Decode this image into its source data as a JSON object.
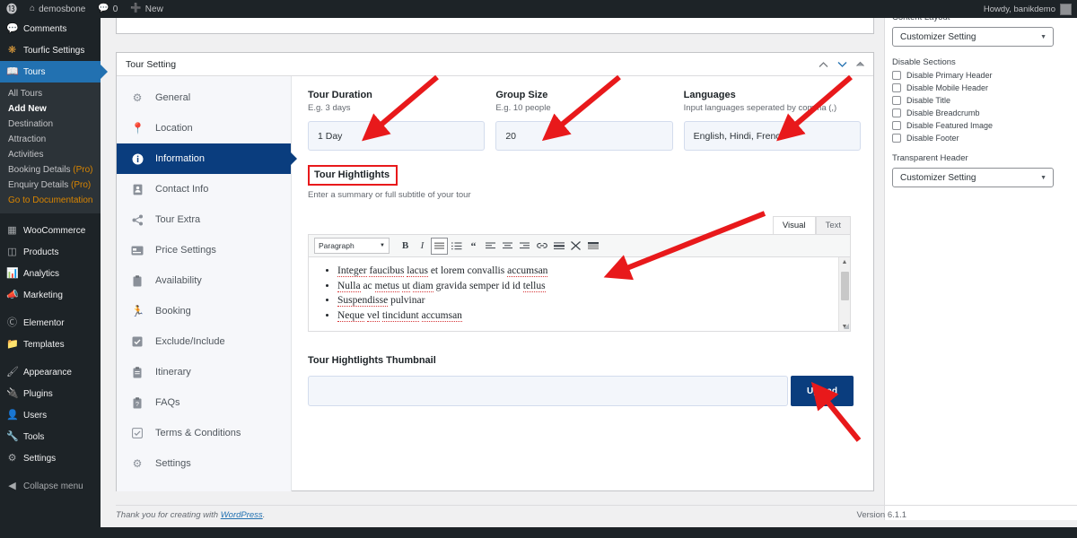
{
  "adminbar": {
    "wp_logo": "wordpress-logo-icon",
    "site_name": "demosbone",
    "comments_count": "0",
    "new_label": "New",
    "howdy": "Howdy, banikdemo"
  },
  "adminmenu": {
    "items": [
      {
        "label": "Comments",
        "icon": "comments-icon",
        "current": false
      },
      {
        "label": "Tourfic Settings",
        "icon": "tourfic-icon",
        "current": false
      },
      {
        "label": "Tours",
        "icon": "tours-icon",
        "current": true
      }
    ],
    "submenu": [
      {
        "label": "All Tours",
        "state": "normal"
      },
      {
        "label": "Add New",
        "state": "current"
      },
      {
        "label": "Destination",
        "state": "normal"
      },
      {
        "label": "Attraction",
        "state": "normal"
      },
      {
        "label": "Activities",
        "state": "normal"
      },
      {
        "label": "Booking Details ",
        "pro": "(Pro)",
        "state": "pro"
      },
      {
        "label": "Enquiry Details ",
        "pro": "(Pro)",
        "state": "pro"
      },
      {
        "label": "Go to Documentation",
        "state": "doc"
      }
    ],
    "items2": [
      {
        "label": "WooCommerce",
        "icon": "woocommerce-icon"
      },
      {
        "label": "Products",
        "icon": "products-icon"
      },
      {
        "label": "Analytics",
        "icon": "analytics-icon"
      },
      {
        "label": "Marketing",
        "icon": "marketing-icon"
      }
    ],
    "items3": [
      {
        "label": "Elementor",
        "icon": "elementor-icon"
      },
      {
        "label": "Templates",
        "icon": "templates-icon"
      }
    ],
    "items4": [
      {
        "label": "Appearance",
        "icon": "appearance-icon"
      },
      {
        "label": "Plugins",
        "icon": "plugins-icon"
      },
      {
        "label": "Users",
        "icon": "users-icon"
      },
      {
        "label": "Tools",
        "icon": "tools-icon"
      },
      {
        "label": "Settings",
        "icon": "settings-icon"
      }
    ],
    "collapse": {
      "label": "Collapse menu",
      "icon": "collapse-icon"
    }
  },
  "postbox": {
    "title": "Tour Setting",
    "controls": [
      {
        "name": "move-up-icon"
      },
      {
        "name": "move-down-icon"
      },
      {
        "name": "toggle-panel-icon"
      }
    ]
  },
  "tabs": [
    {
      "label": "General",
      "icon": "gear-icon",
      "active": false
    },
    {
      "label": "Location",
      "icon": "map-pin-icon",
      "active": false
    },
    {
      "label": "Information",
      "icon": "info-icon",
      "active": true
    },
    {
      "label": "Contact Info",
      "icon": "contact-card-icon",
      "active": false
    },
    {
      "label": "Tour Extra",
      "icon": "share-icon",
      "active": false
    },
    {
      "label": "Price Settings",
      "icon": "credit-card-icon",
      "active": false
    },
    {
      "label": "Availability",
      "icon": "clipboard-icon",
      "active": false
    },
    {
      "label": "Booking",
      "icon": "booking-icon",
      "active": false
    },
    {
      "label": "Exclude/Include",
      "icon": "checkbox-icon",
      "active": false
    },
    {
      "label": "Itinerary",
      "icon": "itinerary-icon",
      "active": false
    },
    {
      "label": "FAQs",
      "icon": "faq-icon",
      "active": false
    },
    {
      "label": "Terms & Conditions",
      "icon": "terms-check-icon",
      "active": false
    },
    {
      "label": "Settings",
      "icon": "settings-gears-icon",
      "active": false
    }
  ],
  "fields": {
    "duration": {
      "label": "Tour Duration",
      "desc": "E.g. 3 days",
      "value": "1 Day"
    },
    "group_size": {
      "label": "Group Size",
      "desc": "E.g. 10 people",
      "value": "20"
    },
    "languages": {
      "label": "Languages",
      "desc": "Input languages seperated by comma (,)",
      "value": "English, Hindi, French"
    }
  },
  "highlights": {
    "label": "Tour Hightlights",
    "desc": "Enter a summary or full subtitle of your tour",
    "highlight_color": "#e8191b",
    "editor": {
      "tabs": [
        {
          "label": "Visual",
          "active": true
        },
        {
          "label": "Text",
          "active": false
        }
      ],
      "format_select": "Paragraph",
      "toolbar": [
        "bold-icon",
        "italic-icon",
        "bulleted-list-icon",
        "numbered-list-icon",
        "blockquote-icon",
        "align-left-icon",
        "align-center-icon",
        "align-right-icon",
        "link-icon",
        "read-more-icon",
        "fullscreen-icon",
        "toolbar-toggle-icon"
      ],
      "list_items": [
        "Integer faucibus lacus et lorem convallis accumsan",
        "Nulla ac metus ut diam gravida semper id id tellus",
        "Suspendisse pulvinar",
        "Neque vel tincidunt accumsan"
      ]
    }
  },
  "thumbnail": {
    "label": "Tour Hightlights Thumbnail",
    "value": "",
    "upload_label": "Upload",
    "button_color": "#0a3d7e"
  },
  "sidebar": {
    "content_layout": {
      "label": "Content Layout",
      "value": "Customizer Setting"
    },
    "disable_sections": {
      "heading": "Disable Sections",
      "options": [
        {
          "label": "Disable Primary Header",
          "checked": false
        },
        {
          "label": "Disable Mobile Header",
          "checked": false
        },
        {
          "label": "Disable Title",
          "checked": false
        },
        {
          "label": "Disable Breadcrumb",
          "checked": false
        },
        {
          "label": "Disable Featured Image",
          "checked": false
        },
        {
          "label": "Disable Footer",
          "checked": false
        }
      ]
    },
    "transparent_header": {
      "label": "Transparent Header",
      "value": "Customizer Setting"
    }
  },
  "footer": {
    "thanks_prefix": "Thank you for creating with ",
    "thanks_link": "WordPress",
    "thanks_suffix": ".",
    "version": "Version 6.1.1"
  }
}
